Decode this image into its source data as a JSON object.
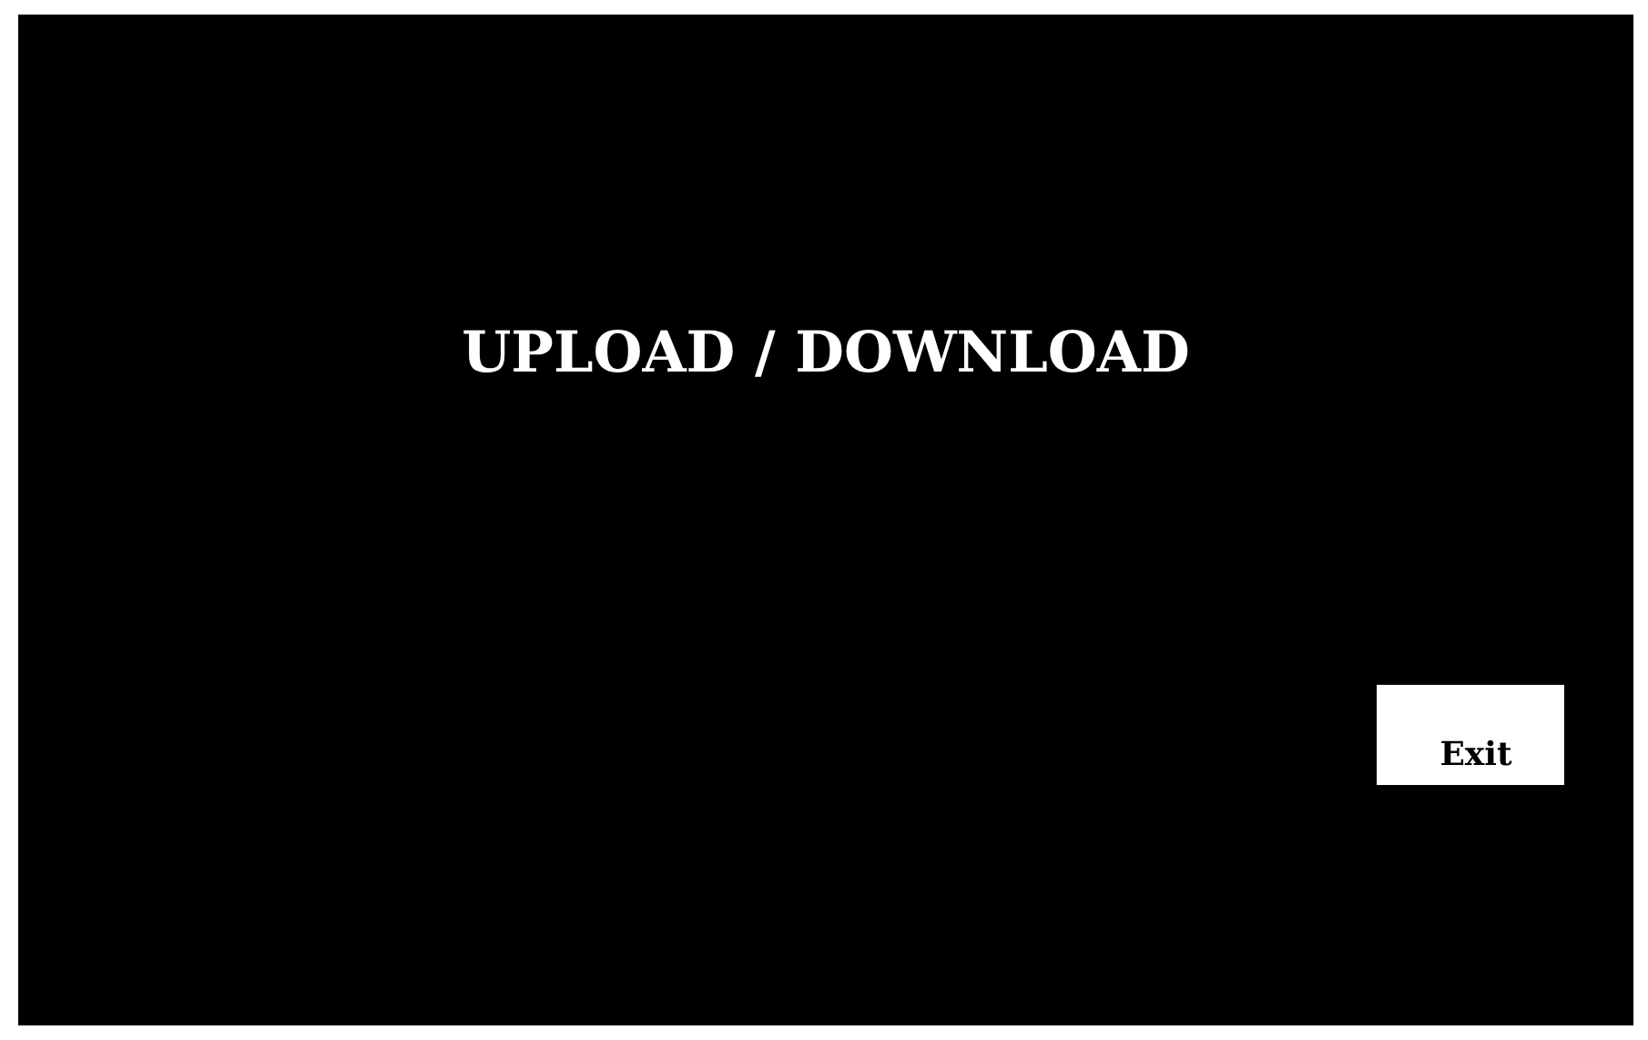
{
  "title": "UPLOAD / DOWNLOAD",
  "buttons": [
    {
      "label": "Exit"
    }
  ]
}
